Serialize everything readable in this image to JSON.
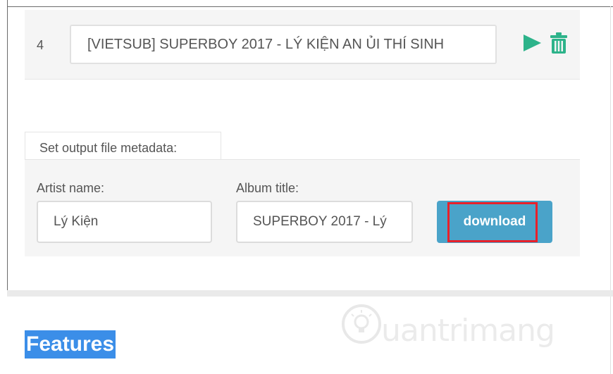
{
  "track": {
    "number": "4",
    "title": "[VIETSUB] SUPERBOY 2017 - LÝ KIỆN AN ỦI THÍ SINH",
    "icons": [
      "play-icon",
      "trash-icon"
    ]
  },
  "metadata": {
    "tab_label": "Set output file metadata:",
    "artist_label": "Artist name:",
    "artist_value": "Lý Kiện",
    "album_label": "Album title:",
    "album_value": "SUPERBOY 2017 - Lý",
    "download_label": "download"
  },
  "features_heading": "Features",
  "watermark": "uantrimang",
  "colors": {
    "accent_green": "#2db38a",
    "download_button": "#4aa3c9",
    "highlight_red": "#e8202a",
    "selection_blue": "#3b8ee8"
  }
}
